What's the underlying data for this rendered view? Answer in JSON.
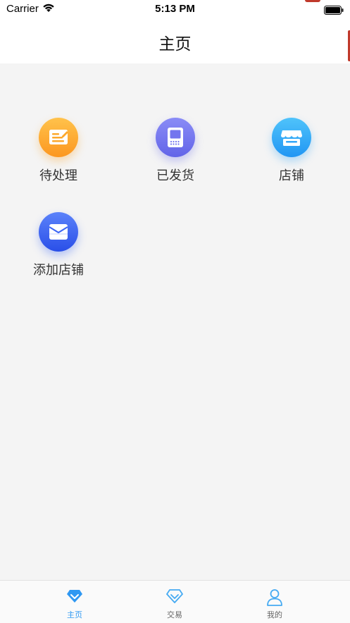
{
  "status_bar": {
    "carrier": "Carrier",
    "time": "5:13 PM"
  },
  "nav": {
    "title": "主页"
  },
  "grid": {
    "items": [
      {
        "label": "待处理",
        "icon": "pending-icon",
        "color": "#FDA82B"
      },
      {
        "label": "已发货",
        "icon": "shipped-icon",
        "color": "#7375EE"
      },
      {
        "label": "店铺",
        "icon": "store-icon",
        "color": "#34A7F8"
      },
      {
        "label": "添加店铺",
        "icon": "add-store-icon",
        "color": "#3C66F5"
      }
    ]
  },
  "tab_bar": {
    "tabs": [
      {
        "label": "主页",
        "icon": "diamond-icon",
        "active": true,
        "color": "#2F98F2"
      },
      {
        "label": "交易",
        "icon": "diamond-outline-icon",
        "active": false,
        "color": "#45AAF2"
      },
      {
        "label": "我的",
        "icon": "user-icon",
        "active": false,
        "color": "#45AAF2"
      }
    ],
    "label_active_color": "#2F98F2",
    "label_inactive_color": "#666666"
  }
}
